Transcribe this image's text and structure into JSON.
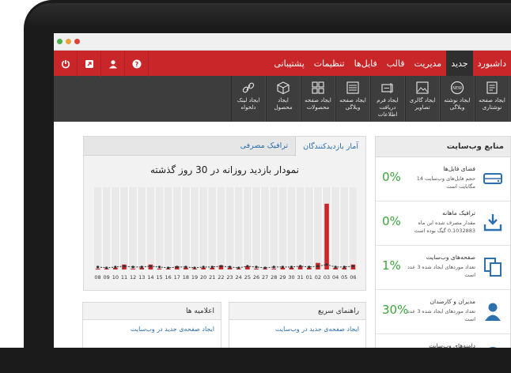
{
  "colors": {
    "accent": "#c9262a",
    "toolbar": "#3d3d3d",
    "link": "#2a6fb0",
    "percent": "#3aa53a",
    "icon": "#2e6fae"
  },
  "nav": {
    "items": [
      {
        "label": "داشبورد",
        "icon": "dashboard-icon"
      },
      {
        "label": "جدید",
        "icon": "new-icon"
      },
      {
        "label": "مدیریت",
        "icon": "manage-icon"
      },
      {
        "label": "قالب",
        "icon": "template-icon"
      },
      {
        "label": "فایل‌ها",
        "icon": "files-icon"
      },
      {
        "label": "تنظیمات",
        "icon": "settings-icon"
      },
      {
        "label": "پشتیبانی",
        "icon": "support-icon"
      }
    ],
    "active_index": 1
  },
  "toolbar": {
    "items": [
      {
        "label": "ایجاد صفحه\nنوشتاری",
        "icon": "page-icon"
      },
      {
        "label": "ایجاد نوشته\nوبلاگی",
        "icon": "new-badge-icon"
      },
      {
        "label": "ایجاد گالری\nتصاویر",
        "icon": "gallery-icon"
      },
      {
        "label": "ایجاد فرم\nدریافت اطلاعات",
        "icon": "form-icon"
      },
      {
        "label": "ایجاد صفحه\nوبلاگی",
        "icon": "list-icon"
      },
      {
        "label": "ایجاد صفحه\nمحصولات",
        "icon": "grid-icon"
      },
      {
        "label": "ایجاد\nمحصول",
        "icon": "box-icon"
      },
      {
        "label": "ایجاد لینک\nدلخواه",
        "icon": "link-icon"
      }
    ]
  },
  "resources": {
    "title": "منابع وب‌سایت",
    "items": [
      {
        "title": "فضای فایل‌ها",
        "desc": "حجم فایل‌های وب‌سایت 14 مگابایت است",
        "percent": "0%",
        "icon": "storage-icon"
      },
      {
        "title": "ترافیک ماهانه",
        "desc": "مقدار مصرف شده این ماه 0.1032883 گیگ بوده است",
        "percent": "0%",
        "icon": "download-icon"
      },
      {
        "title": "صفحه‌های وب‌سایت",
        "desc": "تعداد موردهای ایجاد شده 3 عدد است",
        "percent": "1%",
        "icon": "pages-icon"
      },
      {
        "title": "مدیران و کارمندان",
        "desc": "تعداد موردهای ایجاد شده 3 عدد است",
        "percent": "30%",
        "icon": "user-icon"
      },
      {
        "title": "دامنه‌های وب‌سایت",
        "desc": "",
        "percent": "",
        "icon": "globe-icon"
      }
    ]
  },
  "stats": {
    "tabs": [
      {
        "label": "آمار بازدیدکنندگان"
      },
      {
        "label": "ترافیک مصرفی"
      }
    ],
    "active_tab": 0
  },
  "panels": {
    "quick": {
      "title": "راهنمای سریع",
      "link": "ایجاد صفحه‌ی جدید در وب‌سایت"
    },
    "notices": {
      "title": "اعلامیه ها",
      "link": "ایجاد صفحه‌ی جدید در وب‌سایت"
    }
  },
  "chart_data": {
    "type": "bar",
    "title": "نمودار بازدید روزانه در 30 روز گذشته",
    "categories": [
      "08",
      "09",
      "10",
      "11",
      "12",
      "13",
      "14",
      "15",
      "16",
      "17",
      "18",
      "19",
      "20",
      "21",
      "22",
      "23",
      "24",
      "25",
      "26",
      "27",
      "28",
      "29",
      "30",
      "31",
      "01",
      "02",
      "03",
      "04",
      "05",
      "06"
    ],
    "series": [
      {
        "values": [
          1,
          1,
          2,
          6,
          1,
          2,
          6,
          1,
          1,
          4,
          2,
          1,
          2,
          2,
          5,
          2,
          1,
          4,
          1,
          1,
          1,
          2,
          2,
          4,
          2,
          8,
          80,
          2,
          2,
          6
        ],
        "color": "#c9262a"
      },
      {
        "values": [
          3,
          2,
          3,
          4,
          3,
          3,
          4,
          3,
          2,
          3,
          3,
          2,
          3,
          3,
          4,
          3,
          2,
          4,
          3,
          2,
          3,
          3,
          3,
          4,
          3,
          4,
          6,
          3,
          3,
          4
        ],
        "color": "#333333"
      }
    ],
    "ylim": [
      0,
      100
    ]
  }
}
